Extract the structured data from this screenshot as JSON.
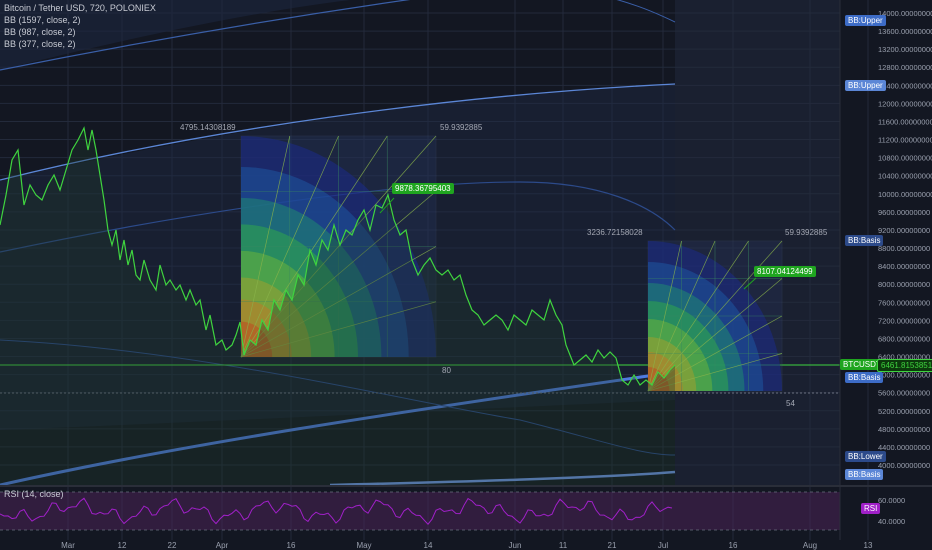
{
  "header": {
    "title": "Bitcoin / Tether USD, 720, POLONIEX",
    "indicators": [
      "BB (1597, close, 2)",
      "BB (987, close, 2)",
      "BB (377, close, 2)"
    ]
  },
  "rsi_legend": "RSI (14, close)",
  "annotations": {
    "fib1_left": "4795.14308189",
    "fib1_right": "59.9392885",
    "fib1_bottom": "80",
    "fib1_price": "9878.36795403",
    "fib2_left": "3236.72158028",
    "fib2_right": "59.9392885",
    "fib2_bottom": "54",
    "fib2_price": "8107.04124499"
  },
  "tags": {
    "bb_upper_1": "BB:Upper",
    "bb_upper_2": "BB:Upper",
    "bb_basis_1": "BB:Basis",
    "symbol": "BTCUSDT",
    "last_price": "6461.81538513",
    "bb_basis_2": "BB:Basis",
    "bb_lower": "BB:Lower",
    "bb_basis_3": "BB:Basis",
    "rsi": "RSI"
  },
  "colors": {
    "background": "#131722",
    "price_line": "#3fd43f",
    "bb_line": "#5b86d6",
    "rsi_line": "#a020c8",
    "rsi_fill": "#4a2356",
    "tag_blue": "#3d6cc7",
    "tag_green": "#1fa51f"
  },
  "chart_data": {
    "type": "line",
    "title": "Bitcoin / Tether USD, 720, POLONIEX",
    "y_ticks": [
      "14000.00000000",
      "13600.00000000",
      "13200.00000000",
      "12800.00000000",
      "12400.00000000",
      "12000.00000000",
      "11600.00000000",
      "11200.00000000",
      "10800.00000000",
      "10400.00000000",
      "10000.00000000",
      "9600.00000000",
      "9200.00000000",
      "8800.00000000",
      "8400.00000000",
      "8000.00000000",
      "7600.00000000",
      "7200.00000000",
      "6800.00000000",
      "6400.00000000",
      "6000.00000000",
      "5600.00000000",
      "5200.00000000",
      "4800.00000000",
      "4400.00000000",
      "4000.00000000"
    ],
    "ylim": [
      3900,
      14100
    ],
    "rsi_ticks": [
      "60.0000",
      "40.0000"
    ],
    "x_ticks": [
      "Mar",
      "12",
      "22",
      "Apr",
      "16",
      "May",
      "14",
      "Jun",
      "11",
      "21",
      "Jul",
      "16",
      "Aug",
      "13"
    ],
    "price_series": {
      "name": "BTCUSDT",
      "x": [
        "Feb 23",
        "Feb 28",
        "Mar 3",
        "Mar 5",
        "Mar 8",
        "Mar 12",
        "Mar 15",
        "Mar 18",
        "Mar 22",
        "Mar 26",
        "Mar 30",
        "Apr 1",
        "Apr 5",
        "Apr 10",
        "Apr 14",
        "Apr 18",
        "Apr 22",
        "Apr 25",
        "Apr 28",
        "May 2",
        "May 5",
        "May 8",
        "May 12",
        "May 16",
        "May 20",
        "May 25",
        "May 29",
        "Jun 2",
        "Jun 6",
        "Jun 10",
        "Jun 13",
        "Jun 17",
        "Jun 21",
        "Jun 24",
        "Jun 28",
        "Jul 1",
        "Jul 4"
      ],
      "values": [
        10500,
        11100,
        11300,
        11500,
        10800,
        9400,
        8300,
        8200,
        8700,
        7900,
        7000,
        6800,
        7000,
        6800,
        7900,
        8200,
        8900,
        9300,
        9600,
        9800,
        9100,
        8600,
        8700,
        8400,
        8200,
        7500,
        7200,
        7400,
        7600,
        6800,
        6600,
        6500,
        6700,
        6100,
        6200,
        6300,
        6550
      ]
    }
  }
}
